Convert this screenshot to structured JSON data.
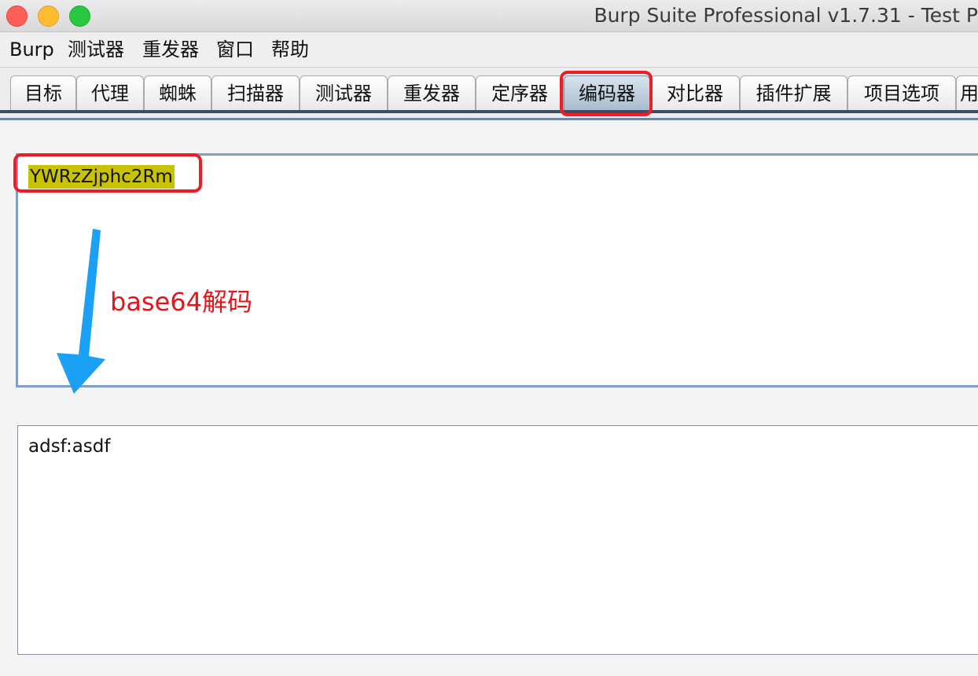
{
  "window": {
    "title": "Burp Suite Professional v1.7.31 - Test P",
    "controls": [
      "close-icon",
      "minimize-icon",
      "maximize-icon"
    ]
  },
  "menu": {
    "items": [
      "Burp",
      "测试器",
      "重发器",
      "窗口",
      "帮助"
    ]
  },
  "tabs": {
    "items": [
      "目标",
      "代理",
      "蜘蛛",
      "扫描器",
      "测试器",
      "重发器",
      "定序器",
      "编码器",
      "对比器",
      "插件扩展",
      "项目选项",
      "用"
    ],
    "active": "编码器"
  },
  "encoder": {
    "input_text": "YWRzZjphc2Rm",
    "output_text": "adsf:asdf",
    "annotation": "base64解码"
  },
  "colors": {
    "highlight": "#ee1c25",
    "selection": "#c8c200",
    "arrow": "#1aa0f5",
    "annotation": "#e8141c"
  }
}
